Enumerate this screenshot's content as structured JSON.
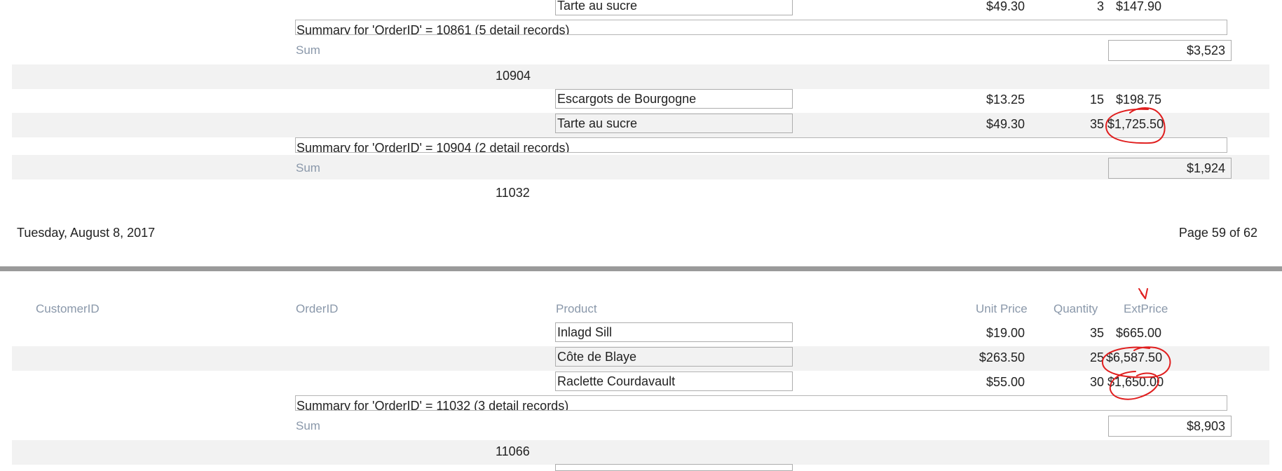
{
  "page1": {
    "row_top": {
      "product": "Tarte au sucre",
      "unit_price": "$49.30",
      "quantity": "3",
      "ext_price": "$147.90"
    },
    "summary_10861": "Summary for 'OrderID' =  10861 (5 detail records)",
    "sum_label": "Sum",
    "sum_10861": "$3,523",
    "order_10904": "10904",
    "rows_10904": [
      {
        "product": "Escargots de Bourgogne",
        "unit_price": "$13.25",
        "quantity": "15",
        "ext_price": "$198.75"
      },
      {
        "product": "Tarte au sucre",
        "unit_price": "$49.30",
        "quantity": "35",
        "ext_price": "$1,725.50"
      }
    ],
    "summary_10904": "Summary for 'OrderID' =  10904 (2 detail records)",
    "sum_10904": "$1,924",
    "order_11032": "11032",
    "footer_date": "Tuesday, August 8, 2017",
    "footer_page": "Page 59 of 62"
  },
  "page2": {
    "headers": {
      "customer_id": "CustomerID",
      "order_id": "OrderID",
      "product": "Product",
      "unit_price": "Unit Price",
      "quantity": "Quantity",
      "ext_price": "ExtPrice"
    },
    "rows_11032": [
      {
        "product": "Inlagd Sill",
        "unit_price": "$19.00",
        "quantity": "35",
        "ext_price": "$665.00"
      },
      {
        "product": "Côte de Blaye",
        "unit_price": "$263.50",
        "quantity": "25",
        "ext_price": "$6,587.50"
      },
      {
        "product": "Raclette Courdavault",
        "unit_price": "$55.00",
        "quantity": "30",
        "ext_price": "$1,650.00"
      }
    ],
    "summary_11032": "Summary for 'OrderID' =  11032 (3 detail records)",
    "sum_label": "Sum",
    "sum_11032": "$8,903",
    "order_11066": "11066"
  },
  "annotation_color": "#e01e1e"
}
